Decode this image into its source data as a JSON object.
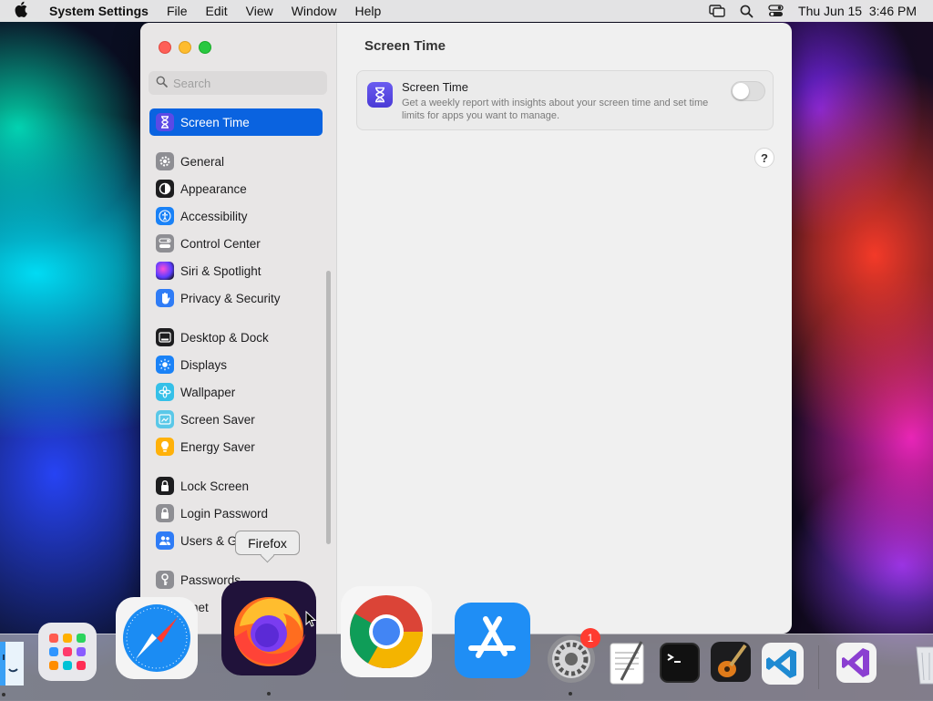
{
  "menubar": {
    "app_name": "System Settings",
    "items": [
      "File",
      "Edit",
      "View",
      "Window",
      "Help"
    ],
    "clock": "Thu Jun 15  3:46 PM"
  },
  "sidebar": {
    "search_placeholder": "Search",
    "selected_item": "Screen Time",
    "groups": [
      [
        "General",
        "Appearance",
        "Accessibility",
        "Control Center",
        "Siri & Spotlight",
        "Privacy & Security"
      ],
      [
        "Desktop & Dock",
        "Displays",
        "Wallpaper",
        "Screen Saver",
        "Energy Saver"
      ],
      [
        "Lock Screen",
        "Login Password",
        "Users & G",
        "Passwords",
        "ernet"
      ]
    ]
  },
  "content": {
    "page_title": "Screen Time",
    "card": {
      "title": "Screen Time",
      "description": "Get a weekly report with insights about your screen time and set time limits for apps you want to manage.",
      "toggle_on": false
    },
    "help_label": "?"
  },
  "tooltip": {
    "text": "Firefox"
  },
  "dock": {
    "apps": [
      "Finder",
      "Launchpad",
      "Safari",
      "Firefox",
      "Chrome",
      "App Store",
      "System Settings",
      "TextEdit",
      "Terminal",
      "GarageBand",
      "Visual Studio Code",
      "Visual Studio",
      "Trash"
    ],
    "settings_badge": "1"
  },
  "colors": {
    "selection": "#0a63e0",
    "badge": "#ff3b30"
  }
}
